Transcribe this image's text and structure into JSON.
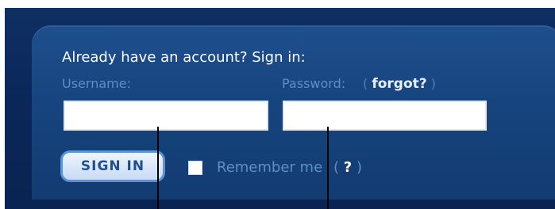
{
  "login": {
    "headline": "Already have an account? Sign in:",
    "username_label": "Username:",
    "password_label": "Password:",
    "forgot_open": "(",
    "forgot_link": "forgot?",
    "forgot_close": ")",
    "username_value": "",
    "password_value": "",
    "signin_label": "SIGN IN",
    "remember_label": "Remember me",
    "help_open": "(",
    "help_link": "?",
    "help_close": ")"
  },
  "colors": {
    "background": "#0b275a",
    "card": "#17457f",
    "label": "#5f8dc8",
    "button_border": "#5c92d6",
    "button_text": "#1f4f93"
  }
}
